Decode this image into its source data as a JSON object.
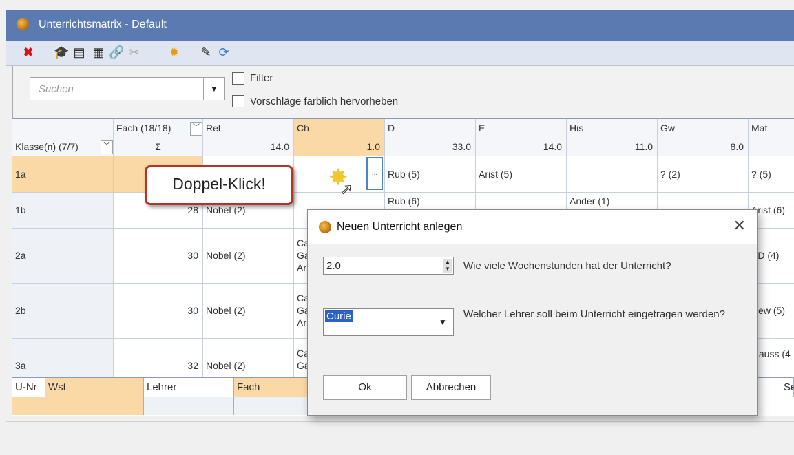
{
  "window": {
    "title": "Unterrichtsmatrix - Default"
  },
  "toolbar": {
    "icons": [
      "delete-icon",
      "teacher-icon",
      "card-icon",
      "class-icon",
      "link-icon",
      "broken-link-icon",
      "settings-icon",
      "edit-icon",
      "refresh-icon"
    ]
  },
  "filter": {
    "search_placeholder": "Suchen",
    "filter_label": "Filter",
    "highlight_label": "Vorschläge farblich hervorheben"
  },
  "grid": {
    "header1": {
      "fach": "Fach (18/18)",
      "subjects": [
        "Rel",
        "Ch",
        "D",
        "E",
        "His",
        "Gw",
        "Mat"
      ]
    },
    "header2": {
      "klasse": "Klasse(n) (7/7)",
      "sigma": "Σ",
      "totals": [
        "14.0",
        "1.0",
        "33.0",
        "14.0",
        "11.0",
        "8.0",
        ""
      ]
    },
    "rows": [
      {
        "cls": "1a",
        "sum": "",
        "cells": [
          "",
          "",
          "Rub (5)",
          "Arist (5)",
          "",
          "? (2)",
          "? (5)"
        ]
      },
      {
        "cls": "1b",
        "sum": "28",
        "cells": [
          "Nobel (2)",
          "",
          "Rub (6)",
          "",
          "Ander (1)",
          "",
          "Arist (6)"
        ]
      },
      {
        "cls": "2a",
        "sum": "30",
        "cells": [
          "Nobel (2)",
          "Ca\nGa\nAr",
          "",
          "",
          "",
          "",
          "AD (4)"
        ]
      },
      {
        "cls": "2b",
        "sum": "30",
        "cells": [
          "Nobel (2)",
          "Ca\nGa\nAr",
          "",
          "",
          "",
          "",
          "New (5)"
        ]
      },
      {
        "cls": "3a",
        "sum": "32",
        "cells": [
          "Nobel (2)",
          "Ca\nGa",
          "",
          "",
          "",
          "",
          "Gauss (4"
        ]
      }
    ],
    "edit_button": "..."
  },
  "bottom": {
    "headers": [
      "U-Nr",
      "Wst",
      "Lehrer",
      "Fach",
      "Se"
    ]
  },
  "callout": {
    "text": "Doppel-Klick!"
  },
  "dialog": {
    "title": "Neuen Unterricht anlegen",
    "hours_value": "2.0",
    "hours_question": "Wie viele Wochenstunden hat der Unterricht?",
    "teacher_value": "Curie",
    "teacher_question": "Welcher Lehrer soll beim Unterricht eingetragen werden?",
    "ok": "Ok",
    "cancel": "Abbrechen"
  },
  "colors": {
    "titlebar": "#5b7ab1",
    "selected": "#fad9a6",
    "accent": "#2a62c7",
    "callout_border": "#b53327"
  }
}
